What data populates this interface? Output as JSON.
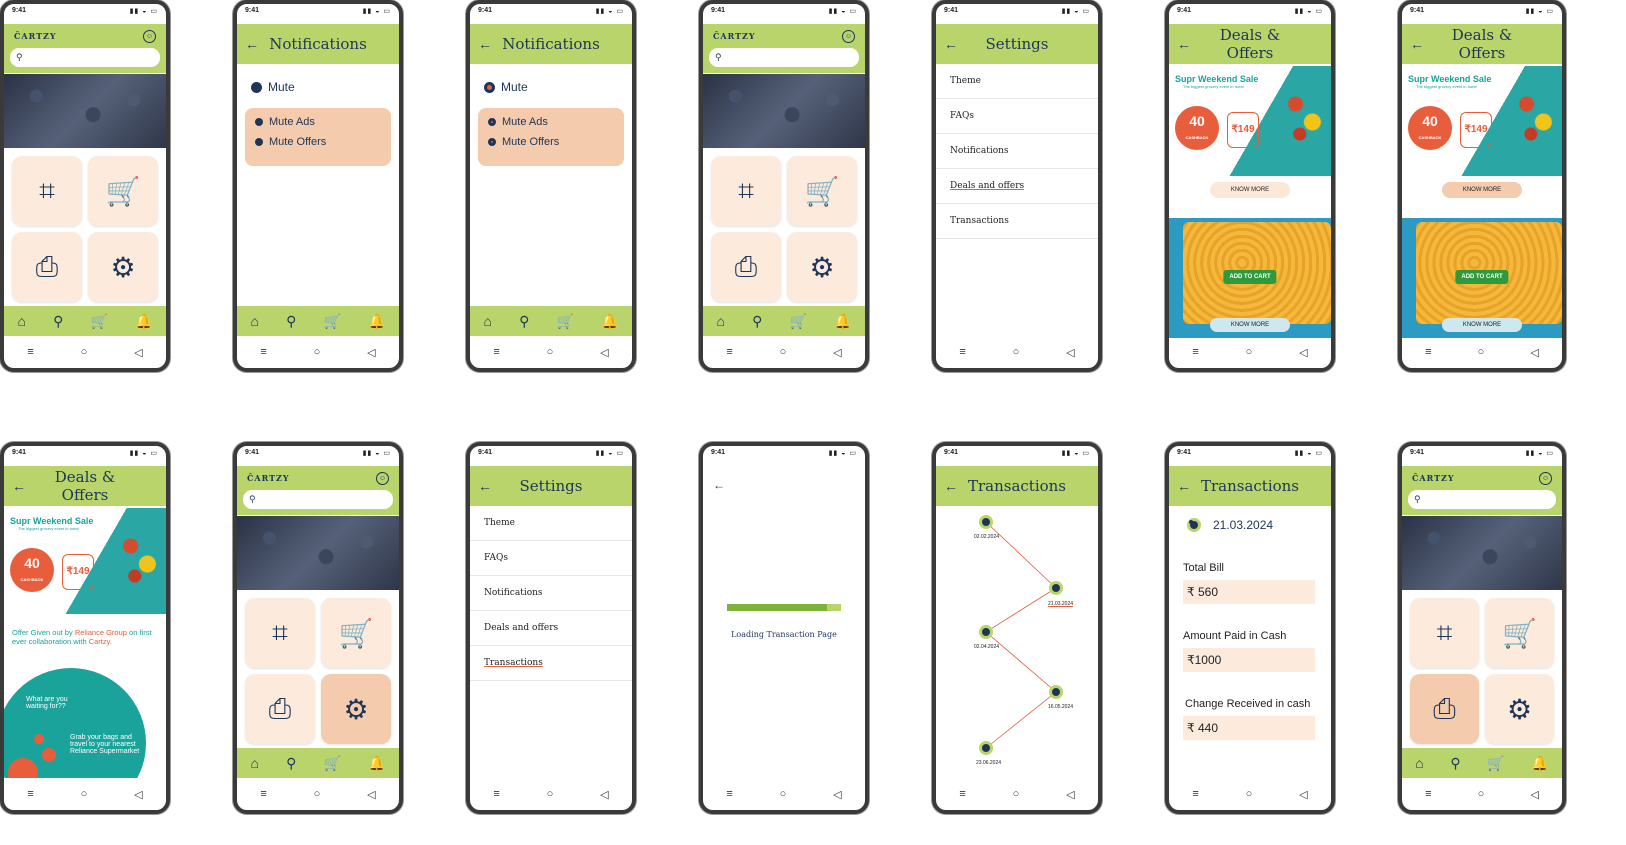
{
  "status": {
    "time": "9:41",
    "signal": "▮▮ ◒ ▭"
  },
  "brand": {
    "logo": "ĈARTZY"
  },
  "colors": {
    "accent": "#b9d46b",
    "navy": "#1d3557",
    "peach": "#fcebdc",
    "orange": "#e85d3b",
    "teal": "#1aa39b"
  },
  "home_nav": [
    "home-icon",
    "search-icon",
    "cart-icon",
    "bell-icon"
  ],
  "notifications": {
    "title": "Notifications",
    "mute": "Mute",
    "mute_ads": "Mute Ads",
    "mute_offers": "Mute Offers"
  },
  "settings": {
    "title": "Settings",
    "items": [
      "Theme",
      "FAQs",
      "Notifications",
      "Deals and offers",
      "Transactions"
    ]
  },
  "deals": {
    "title": "Deals & Offers",
    "banner_title": "Supr Weekend Sale",
    "banner_sub": "The biggest grocery event in town!",
    "banner_date": "3rd & 4th April",
    "cashback": "40",
    "cashback_unit": "%",
    "cashback_label": "CASHBACK",
    "price": "₹149",
    "know_more": "KNOW MORE",
    "add_to_cart": "ADD TO CART",
    "offer_prefix": "Offer Given out by",
    "offer_group": "Reliance Group",
    "offer_mid": "on first ever collaboration with",
    "offer_brand": "Cartzy.",
    "waiting": "What are you waiting for??",
    "grab": "Grab your bags and travel to your nearest Reliance Supermarket"
  },
  "loading": {
    "text": "Loading Transaction Page",
    "progress": 0.88
  },
  "transactions": {
    "title": "Transactions",
    "dates": [
      "02.02.2024",
      "21.03.2024",
      "02.04.2024",
      "16.05.2024",
      "23.06.2024"
    ],
    "detail_date": "21.03.2024",
    "total_bill_label": "Total Bill",
    "total_bill": "₹ 560",
    "paid_label": "Amount Paid in Cash",
    "paid": "₹1000",
    "change_label": "Change Received in cash",
    "change": "₹ 440"
  },
  "sysnav": [
    "menu-icon",
    "home-circle-icon",
    "back-triangle-icon"
  ]
}
